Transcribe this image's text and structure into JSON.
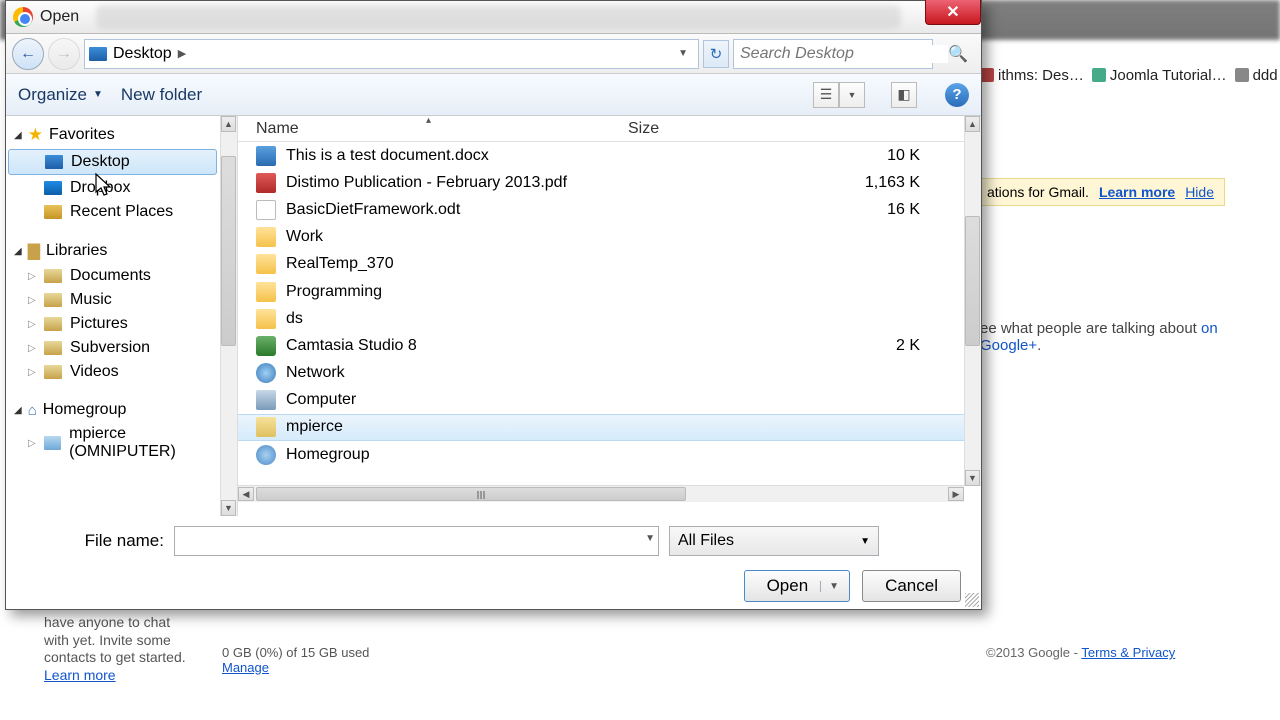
{
  "dialog": {
    "title": "Open",
    "breadcrumb": {
      "location": "Desktop"
    },
    "search_placeholder": "Search Desktop",
    "toolbar": {
      "organize": "Organize",
      "new_folder": "New folder"
    },
    "columns": {
      "name": "Name",
      "size": "Size"
    },
    "tree": {
      "favorites": {
        "label": "Favorites",
        "items": [
          "Desktop",
          "Dropbox",
          "Recent Places"
        ]
      },
      "libraries": {
        "label": "Libraries",
        "items": [
          "Documents",
          "Music",
          "Pictures",
          "Subversion",
          "Videos"
        ]
      },
      "homegroup": {
        "label": "Homegroup",
        "items": [
          "mpierce (OMNIPUTER)"
        ]
      }
    },
    "files": [
      {
        "name": "This is a test document.docx",
        "size": "10 K",
        "icon": "docx"
      },
      {
        "name": "Distimo Publication - February 2013.pdf",
        "size": "1,163 K",
        "icon": "pdf"
      },
      {
        "name": "BasicDietFramework.odt",
        "size": "16 K",
        "icon": "odt"
      },
      {
        "name": "Work",
        "size": "",
        "icon": "folder"
      },
      {
        "name": "RealTemp_370",
        "size": "",
        "icon": "folder"
      },
      {
        "name": "Programming",
        "size": "",
        "icon": "folder"
      },
      {
        "name": "ds",
        "size": "",
        "icon": "folder"
      },
      {
        "name": "Camtasia Studio 8",
        "size": "2 K",
        "icon": "cam"
      },
      {
        "name": "Network",
        "size": "",
        "icon": "net"
      },
      {
        "name": "Computer",
        "size": "",
        "icon": "comp"
      },
      {
        "name": "mpierce",
        "size": "",
        "icon": "user",
        "selected": true
      },
      {
        "name": "Homegroup",
        "size": "",
        "icon": "hg"
      }
    ],
    "file_name_label": "File name:",
    "filter": "All Files",
    "buttons": {
      "open": "Open",
      "cancel": "Cancel"
    }
  },
  "background": {
    "tabs": [
      "ithms: Des…",
      "Joomla Tutorial…",
      "ddd"
    ],
    "banner_text": "ations for Gmail.",
    "banner_learn": "Learn more",
    "banner_hide": "Hide",
    "gplus_text": "ee what people are talking about ",
    "gplus_link": "on Google+",
    "chat": "have anyone to chat with yet. Invite some contacts to get started.",
    "chat_link": "Learn more",
    "storage_used": "0 GB (0%) of 15 GB used",
    "storage_manage": "Manage",
    "footer_copy": "©2013 Google - ",
    "footer_link": "Terms & Privacy"
  }
}
